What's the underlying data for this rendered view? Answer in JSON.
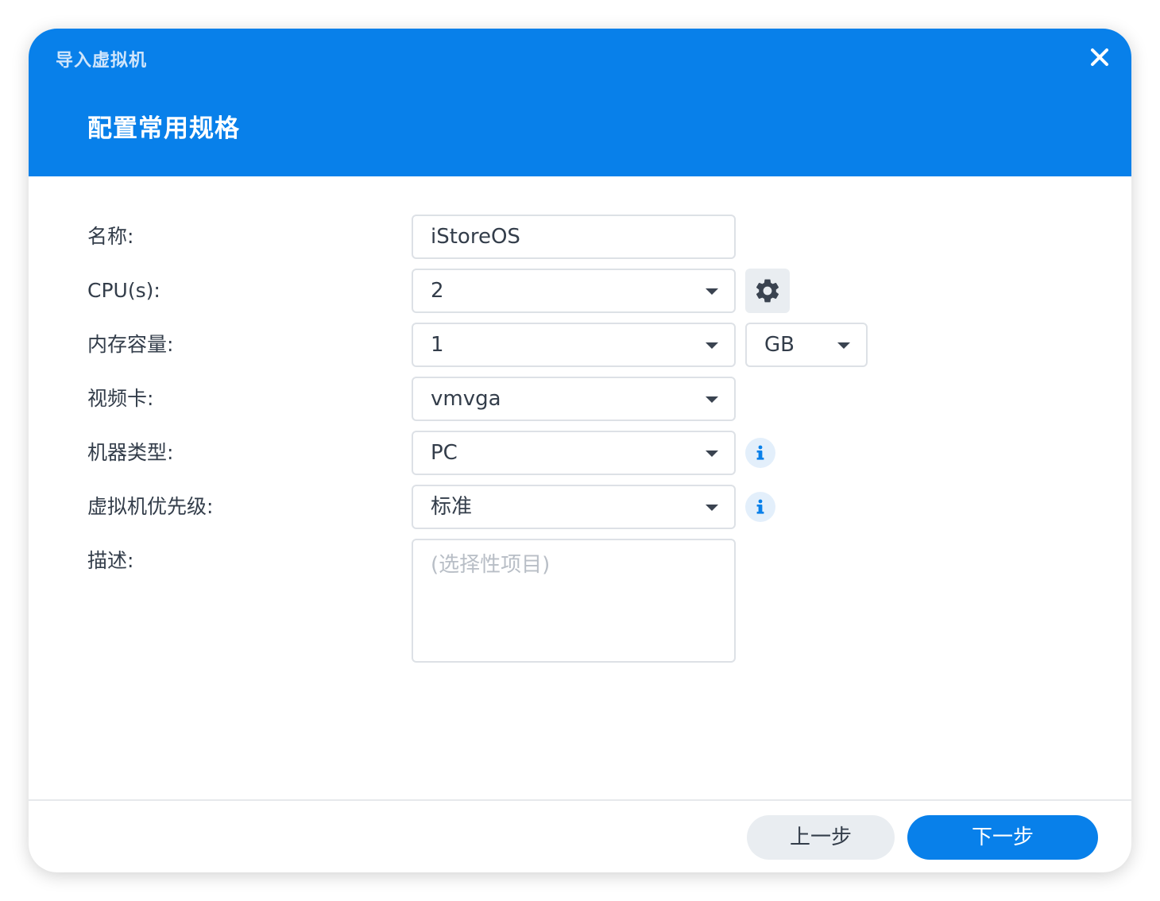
{
  "window": {
    "title": "导入虚拟机",
    "close_icon": "close-icon"
  },
  "step": {
    "title": "配置常用规格"
  },
  "form": {
    "name": {
      "label": "名称:",
      "value": "iStoreOS"
    },
    "cpu": {
      "label": "CPU(s):",
      "value": "2",
      "settings_icon": "gear-icon"
    },
    "memory": {
      "label": "内存容量:",
      "value": "1",
      "unit": "GB"
    },
    "video": {
      "label": "视频卡:",
      "value": "vmvga"
    },
    "machine_type": {
      "label": "机器类型:",
      "value": "PC",
      "info_icon": "info-icon"
    },
    "priority": {
      "label": "虚拟机优先级:",
      "value": "标准",
      "info_icon": "info-icon"
    },
    "description": {
      "label": "描述:",
      "placeholder": "(选择性项目)",
      "value": ""
    }
  },
  "footer": {
    "prev_label": "上一步",
    "next_label": "下一步"
  },
  "colors": {
    "accent": "#0880ea",
    "header_subtitle": "#cfe5fb",
    "text": "#333d4a",
    "border": "#dde1e6",
    "secondary_button": "#e9edf1"
  }
}
